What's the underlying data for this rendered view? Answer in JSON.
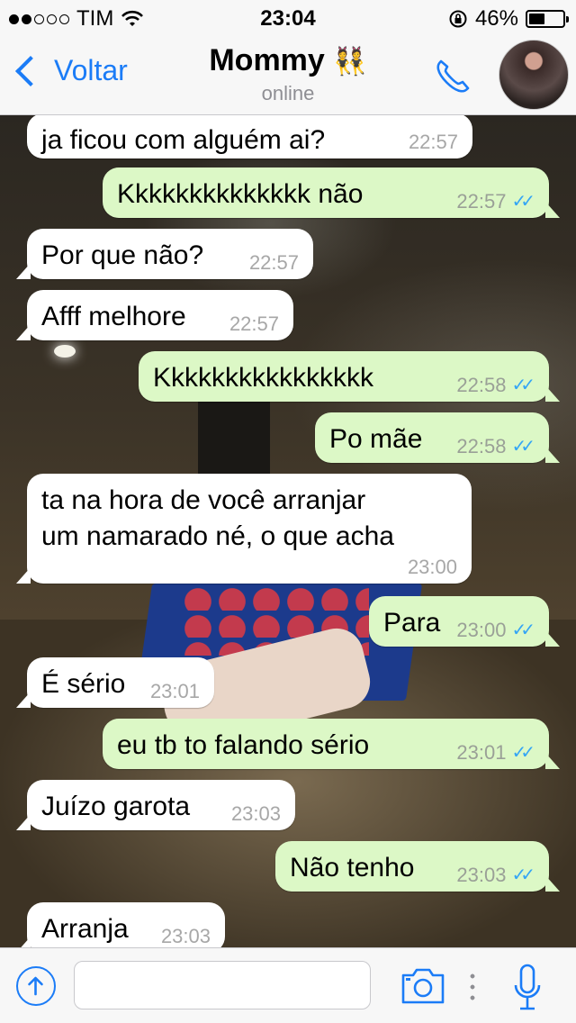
{
  "status_bar": {
    "carrier": "TIM",
    "signal_bars_filled": 2,
    "signal_bars_total": 5,
    "time": "23:04",
    "battery_percent": "46%",
    "battery_level": 0.46
  },
  "header": {
    "back_label": "Voltar",
    "contact_name": "Mommy",
    "contact_emoji": "👯",
    "status": "online"
  },
  "messages": [
    {
      "dir": "in",
      "text": "ja ficou com alguém ai?",
      "time": "22:57"
    },
    {
      "dir": "out",
      "text": "Kkkkkkkkkkkkkk não",
      "time": "22:57",
      "read": true
    },
    {
      "dir": "in",
      "text": "Por que não?",
      "time": "22:57"
    },
    {
      "dir": "in",
      "text": "Afff melhore",
      "time": "22:57"
    },
    {
      "dir": "out",
      "text": "Kkkkkkkkkkkkkkkk",
      "time": "22:58",
      "read": true
    },
    {
      "dir": "out",
      "text": "Po mãe",
      "time": "22:58",
      "read": true
    },
    {
      "dir": "in",
      "text": "ta na hora de você arranjar\num namarado né, o que acha",
      "time": "23:00"
    },
    {
      "dir": "out",
      "text": "Para",
      "time": "23:00",
      "read": true
    },
    {
      "dir": "in",
      "text": "É sério",
      "time": "23:01"
    },
    {
      "dir": "out",
      "text": "eu tb to falando sério",
      "time": "23:01",
      "read": true
    },
    {
      "dir": "in",
      "text": "Juízo garota",
      "time": "23:03"
    },
    {
      "dir": "out",
      "text": "Não tenho",
      "time": "23:03",
      "read": true
    },
    {
      "dir": "in",
      "text": "Arranja",
      "time": "23:03"
    }
  ],
  "icons": {
    "back": "chevron-left-icon",
    "call": "phone-icon",
    "upload": "upload-arrow-icon",
    "camera": "camera-icon",
    "mic": "microphone-icon",
    "read_receipt": "double-check-icon"
  },
  "colors": {
    "accent": "#1b7cf7",
    "outgoing_bubble": "#dcf8c6",
    "incoming_bubble": "#ffffff",
    "read_ticks": "#34a5f5"
  }
}
